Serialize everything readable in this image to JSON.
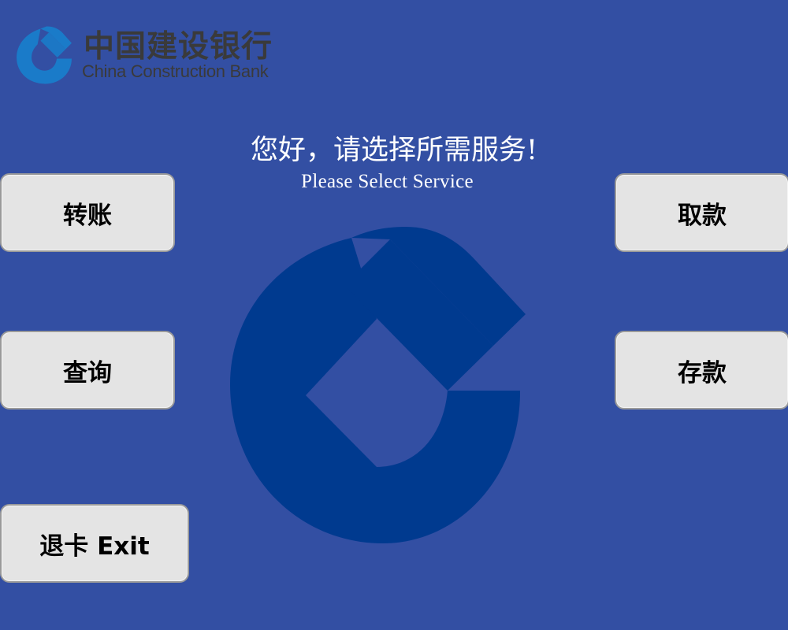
{
  "brand": {
    "name_cn": "中国建设银行",
    "name_en": "China Construction Bank",
    "logo_icon": "ccb-logo-icon",
    "emblem_color": "#003a8f",
    "logo_color": "#1a7bc9"
  },
  "header": {
    "greeting_cn": "您好，请选择所需服务!",
    "greeting_en": "Please Select Service"
  },
  "menu": {
    "transfer": "转账",
    "query": "查询",
    "exit": "退卡 Exit",
    "withdraw": "取款",
    "deposit": "存款"
  },
  "theme": {
    "background": "#334fa3",
    "button_bg": "#e4e4e4"
  }
}
